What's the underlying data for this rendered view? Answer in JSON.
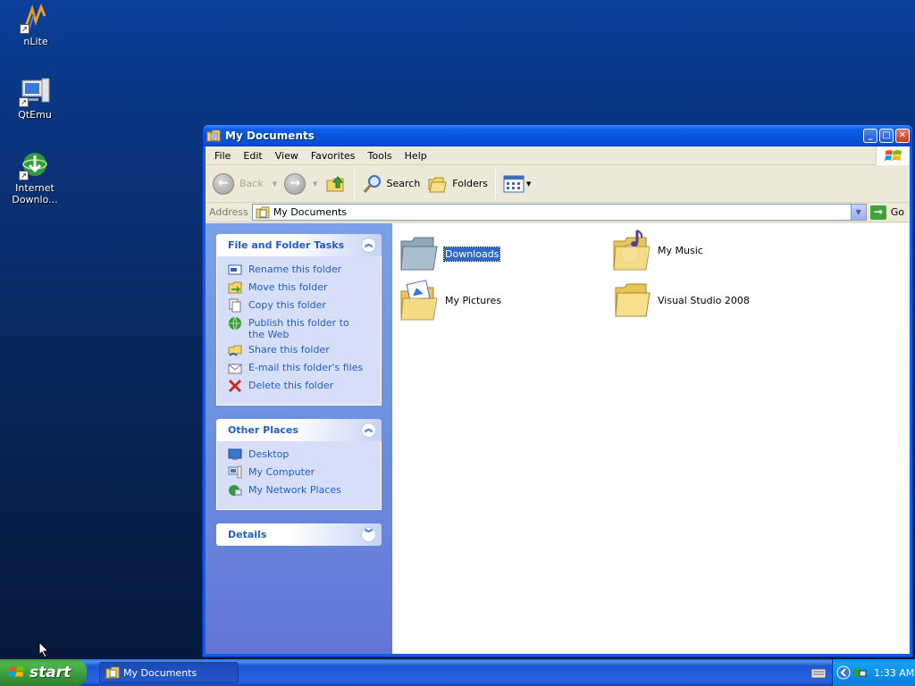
{
  "desktop": {
    "icons": [
      {
        "label": "nLite",
        "icon": "nlite-icon"
      },
      {
        "label": "QtEmu",
        "icon": "qtemu-icon"
      },
      {
        "label": "Internet Downlo...",
        "icon": "internet-download-manager-icon"
      }
    ]
  },
  "window": {
    "title": "My Documents",
    "menu": [
      "File",
      "Edit",
      "View",
      "Favorites",
      "Tools",
      "Help"
    ],
    "toolbar": {
      "back": "Back",
      "search": "Search",
      "folders": "Folders"
    },
    "address": {
      "label": "Address",
      "value": "My Documents",
      "go": "Go"
    },
    "taskpane": {
      "file_tasks": {
        "title": "File and Folder Tasks",
        "items": [
          "Rename this folder",
          "Move this folder",
          "Copy this folder",
          "Publish this folder to the Web",
          "Share this folder",
          "E-mail this folder's files",
          "Delete this folder"
        ]
      },
      "other_places": {
        "title": "Other Places",
        "items": [
          "Desktop",
          "My Computer",
          "My Network Places"
        ]
      },
      "details": {
        "title": "Details"
      }
    },
    "files": [
      {
        "name": "Downloads",
        "selected": true,
        "icon": "folder-icon"
      },
      {
        "name": "My Music",
        "selected": false,
        "icon": "music-folder-icon"
      },
      {
        "name": "My Pictures",
        "selected": false,
        "icon": "pictures-folder-icon"
      },
      {
        "name": "Visual Studio 2008",
        "selected": false,
        "icon": "folder-icon"
      }
    ]
  },
  "taskbar": {
    "start": "start",
    "task_button": "My Documents",
    "clock": "1:33 AM"
  },
  "colors": {
    "selection": "#316ac5",
    "taskpane_link": "#215dc6",
    "start_green": "#3c9b3c"
  }
}
